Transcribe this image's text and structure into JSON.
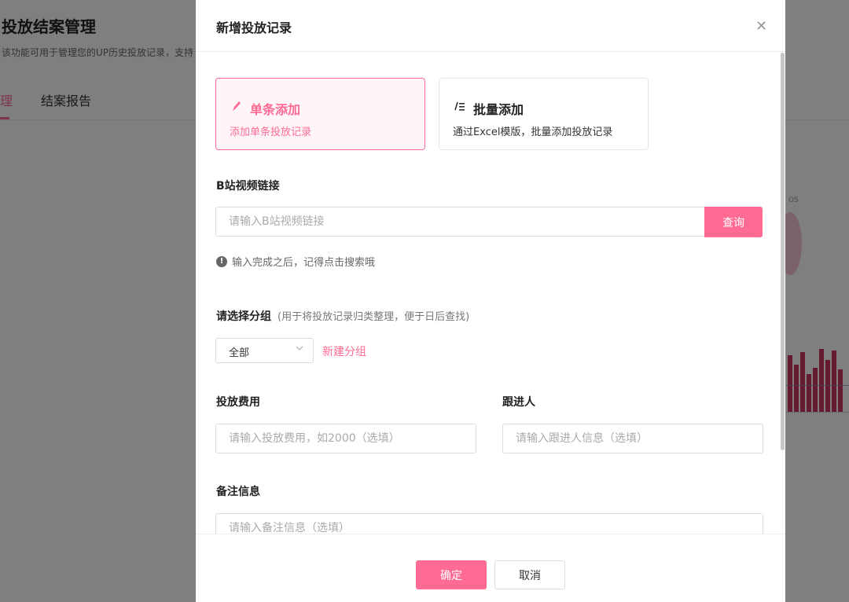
{
  "background": {
    "title": "投放结案管理",
    "description": "该功能可用于管理您的UP历史投放记录，支持",
    "tabs": [
      {
        "label": "理"
      },
      {
        "label": "结案报告"
      }
    ],
    "card_label": "OS",
    "accent_color": "#ff6b93"
  },
  "modal": {
    "title": "新增投放记录",
    "close_icon": "close-icon",
    "options": {
      "single": {
        "icon": "pen-icon",
        "title": "单条添加",
        "desc": "添加单条投放记录",
        "selected": true
      },
      "batch": {
        "icon": "list-edit-icon",
        "title": "批量添加",
        "desc": "通过Excel模版，批量添加投放记录",
        "selected": false
      }
    },
    "video_link": {
      "label": "B站视频链接",
      "placeholder": "请输入B站视频链接",
      "value": "",
      "query_label": "查询",
      "hint": "输入完成之后，记得点击搜索哦"
    },
    "group": {
      "label": "请选择分组",
      "note": "(用于将投放记录归类整理，便于日后查找)",
      "selected": "全部",
      "new_group_label": "新建分组"
    },
    "cost": {
      "label": "投放费用",
      "placeholder": "请输入投放费用，如2000（选填）"
    },
    "follower": {
      "label": "跟进人",
      "placeholder": "请输入跟进人信息（选填）"
    },
    "remark": {
      "label": "备注信息",
      "placeholder": "请输入备注信息（选填）"
    },
    "footer": {
      "ok_label": "确定",
      "cancel_label": "取消"
    }
  }
}
